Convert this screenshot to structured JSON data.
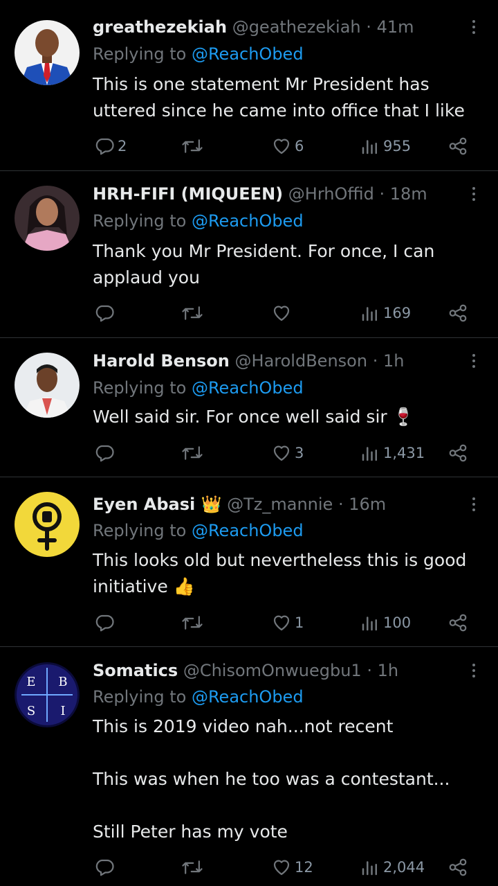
{
  "reply_prefix": "Replying to",
  "tweets": [
    {
      "name": "greathezekiah",
      "handle": "@geathezekiah",
      "sep": "·",
      "time": "41m",
      "reply_to": "@ReachObed",
      "text": "This is one statement Mr President has uttered since he came into office that I like",
      "replies": "2",
      "retweets": "",
      "likes": "6",
      "views": "955"
    },
    {
      "name": "HRH-FIFI (MIQUEEN)",
      "handle": "@HrhOffid",
      "sep": "·",
      "time": "18m",
      "reply_to": "@ReachObed",
      "text": "Thank you Mr President. For once, I can applaud you",
      "replies": "",
      "retweets": "",
      "likes": "",
      "views": "169"
    },
    {
      "name": "Harold Benson",
      "handle": "@HaroldBenson",
      "sep": "·",
      "time": "1h",
      "reply_to": "@ReachObed",
      "text": "Well said sir. For once well said sir 🍷",
      "replies": "",
      "retweets": "",
      "likes": "3",
      "views": "1,431"
    },
    {
      "name": "Eyen Abasi 👑",
      "handle": "@Tz_mannie",
      "sep": "·",
      "time": "16m",
      "reply_to": "@ReachObed",
      "text": "This looks old but nevertheless this is good initiative 👍",
      "replies": "",
      "retweets": "",
      "likes": "1",
      "views": "100"
    },
    {
      "name": "Somatics",
      "handle": "@ChisomOnwuegbu1",
      "sep": "·",
      "time": "1h",
      "reply_to": "@ReachObed",
      "text": "This is 2019 video nah...not recent\n\nThis was when he too was a contestant...\n\nStill Peter has my vote",
      "replies": "",
      "retweets": "",
      "likes": "12",
      "views": "2,044"
    }
  ],
  "icons": {
    "reply": "reply-icon",
    "retweet": "retweet-icon",
    "like": "heart-icon",
    "views": "views-icon",
    "share": "share-icon",
    "more": "more-icon"
  },
  "colors": {
    "background": "#000000",
    "text": "#e7e9ea",
    "muted": "#71767b",
    "link": "#1d9bf0",
    "divider": "#2f3336"
  }
}
